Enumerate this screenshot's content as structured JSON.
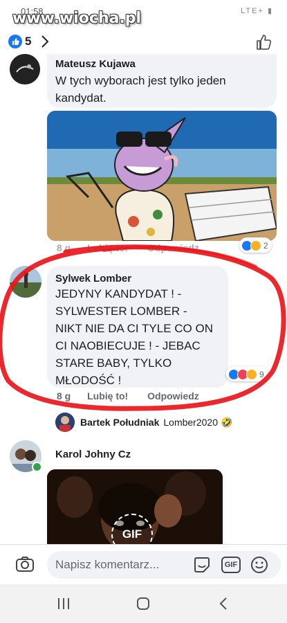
{
  "status": {
    "time": "01:58",
    "icons": "LTE+ ▮"
  },
  "watermark": "www.wiocha.pl",
  "post": {
    "like_count": "5"
  },
  "comments": [
    {
      "author": "Mateusz Kujawa",
      "text_lines": [
        "W tych wyborach jest tylko jeden",
        "kandydat."
      ],
      "meta": {
        "time": "8 g",
        "like": "Lubię to!",
        "reply": "Odpowiedz"
      },
      "reactions_count": "2"
    },
    {
      "author": "Sylwek Lomber",
      "text_lines": [
        "JEDYNY KANDYDAT ! -",
        "SYLWESTER LOMBER -",
        "NIKT NIE DA CI TYLE CO ON",
        "CI NAOBIECUJE ! - JEBAC",
        "STARE BABY, TYLKO",
        "MŁODOŚĆ  !"
      ],
      "meta": {
        "time": "8 g",
        "like": "Lubię to!",
        "reply": "Odpowiedz"
      },
      "reactions_count": "9"
    }
  ],
  "reply": {
    "author": "Bartek Południak",
    "text": "Lomber2020",
    "emoji": "🤣"
  },
  "third_comment": {
    "author": "Karol Johny Cz",
    "gif_label": "GIF"
  },
  "composer": {
    "placeholder": "Napisz komentarz...",
    "gif_button": "GIF"
  }
}
